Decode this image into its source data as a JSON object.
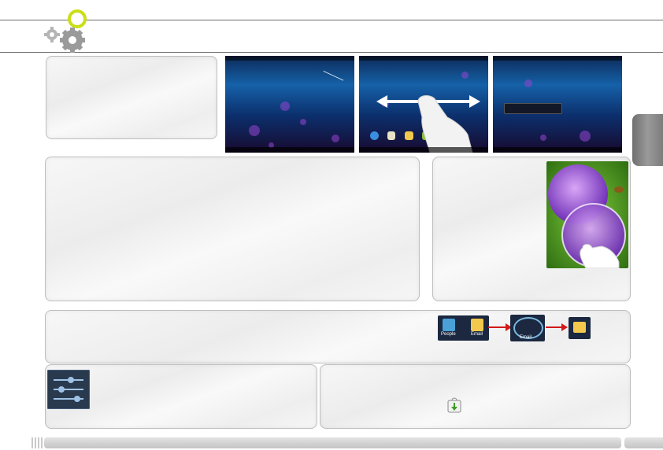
{
  "icons": {
    "header": "settings-gears-icon",
    "settings_app": "settings-sliders-icon",
    "download": "download-bag-icon",
    "folder_flow": [
      "contacts-app-icon",
      "email-app-icon",
      "folder-icon"
    ],
    "gesture": "finger-swipe-icon"
  },
  "folder_flow": {
    "app1_label": "People",
    "app2_label": "Email",
    "folder_label": "Email"
  },
  "colors": {
    "accent_green": "#c9df16",
    "arrow_red": "#d11a1a",
    "rule_gray": "#6b6b6b"
  }
}
